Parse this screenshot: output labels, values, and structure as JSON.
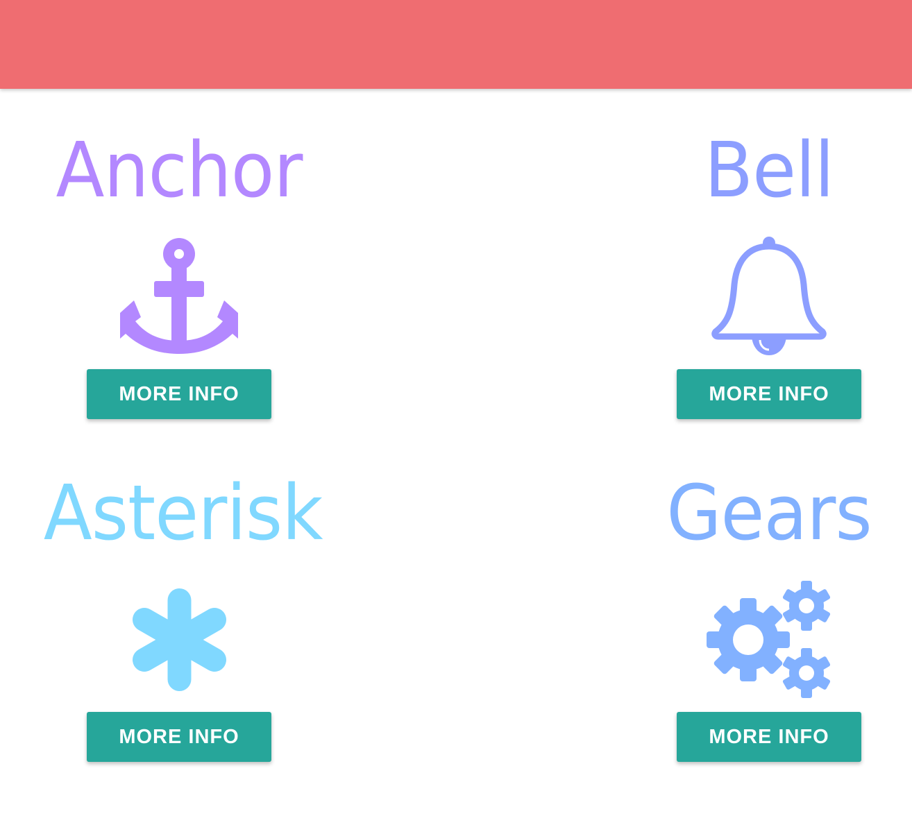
{
  "header": {
    "color": "#ef6d71"
  },
  "cards": [
    {
      "title": "Anchor",
      "icon": "anchor-icon",
      "color": "#b388ff",
      "button_label": "MORE INFO"
    },
    {
      "title": "Bell",
      "icon": "bell-icon",
      "color": "#8c9eff",
      "button_label": "MORE INFO"
    },
    {
      "title": "Asterisk",
      "icon": "asterisk-icon",
      "color": "#80d8ff",
      "button_label": "MORE INFO"
    },
    {
      "title": "Gears",
      "icon": "gears-icon",
      "color": "#82b1ff",
      "button_label": "MORE INFO"
    }
  ],
  "colors": {
    "button_bg": "#26a69a",
    "button_text": "#ffffff"
  }
}
